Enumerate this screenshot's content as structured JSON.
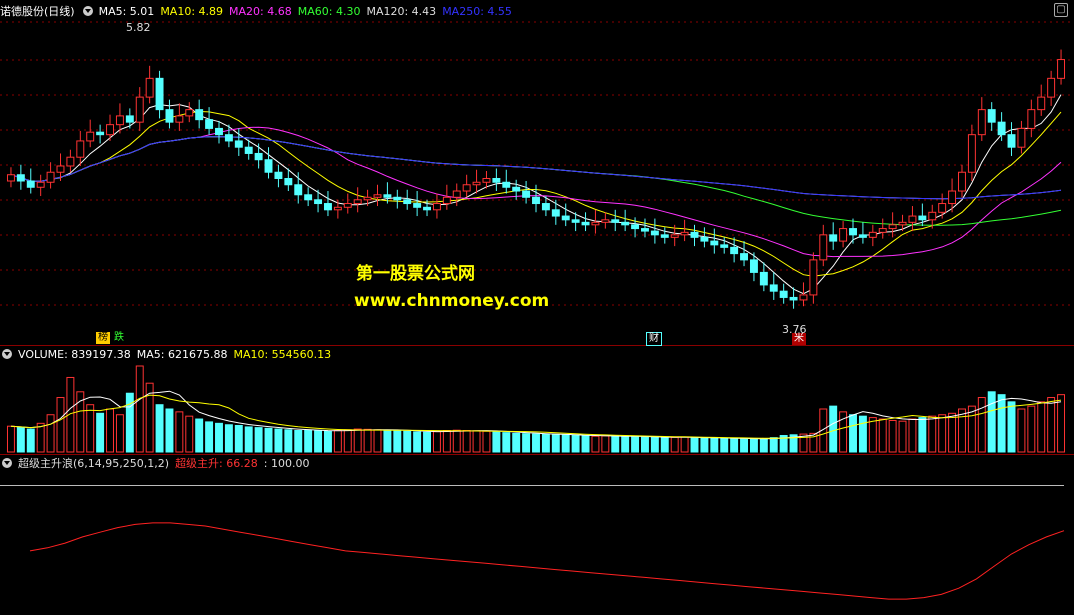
{
  "main_header": {
    "stock_name": "诺德股份(日线)",
    "ma": [
      {
        "label": "MA5: 5.01",
        "color": "#ffffff"
      },
      {
        "label": "MA10: 4.89",
        "color": "#ffff00"
      },
      {
        "label": "MA20: 4.68",
        "color": "#ff33ff"
      },
      {
        "label": "MA60: 4.30",
        "color": "#33ff33"
      },
      {
        "label": "MA120: 4.43",
        "color": "#dddddd"
      },
      {
        "label": "MA250: 4.55",
        "color": "#3333ff"
      }
    ]
  },
  "volume_header": {
    "label": "VOLUME: 839197.38",
    "ma5": "MA5: 621675.88",
    "ma10": "MA10: 554560.13"
  },
  "indicator_header": {
    "name": "超级主升浪(6,14,95,250,1,2)",
    "series": "超级主升: 66.28",
    "level": ": 100.00"
  },
  "annotations": {
    "high": "5.82",
    "low": "3.76",
    "tag_bang": "榜",
    "tag_die": "跌",
    "tag_cai": "财",
    "tag_mi": "米"
  },
  "watermark": {
    "line1": "第一股票公式网",
    "line2": "www.chnmoney.com"
  },
  "colors": {
    "up": "#ff3333",
    "down": "#54ffff",
    "grid": "#8a0000"
  },
  "chart_data": [
    {
      "type": "candlestick",
      "title": "诺德股份(日线)",
      "price_ylim": [
        3.5,
        6.0
      ],
      "high_label": 5.82,
      "low_label": 3.76,
      "ohlc_close": [
        4.78,
        4.73,
        4.68,
        4.72,
        4.8,
        4.85,
        4.92,
        5.05,
        5.12,
        5.1,
        5.18,
        5.25,
        5.2,
        5.4,
        5.55,
        5.3,
        5.2,
        5.25,
        5.3,
        5.22,
        5.15,
        5.1,
        5.05,
        5.0,
        4.95,
        4.9,
        4.8,
        4.75,
        4.7,
        4.62,
        4.58,
        4.55,
        4.5,
        4.52,
        4.55,
        4.58,
        4.6,
        4.62,
        4.6,
        4.58,
        4.55,
        4.52,
        4.5,
        4.55,
        4.6,
        4.65,
        4.7,
        4.72,
        4.75,
        4.72,
        4.68,
        4.65,
        4.6,
        4.55,
        4.5,
        4.45,
        4.42,
        4.4,
        4.38,
        4.4,
        4.42,
        4.4,
        4.38,
        4.35,
        4.33,
        4.3,
        4.28,
        4.3,
        4.32,
        4.28,
        4.25,
        4.22,
        4.2,
        4.15,
        4.1,
        4.0,
        3.9,
        3.85,
        3.8,
        3.78,
        3.82,
        4.1,
        4.3,
        4.25,
        4.35,
        4.3,
        4.28,
        4.32,
        4.35,
        4.38,
        4.4,
        4.45,
        4.42,
        4.48,
        4.55,
        4.65,
        4.8,
        5.1,
        5.3,
        5.2,
        5.1,
        5.0,
        5.15,
        5.3,
        5.4,
        5.55,
        5.7
      ]
    },
    {
      "type": "bar",
      "title": "VOLUME",
      "values": [
        180,
        170,
        160,
        200,
        260,
        380,
        520,
        420,
        330,
        270,
        300,
        260,
        410,
        600,
        480,
        330,
        300,
        280,
        250,
        230,
        210,
        200,
        190,
        185,
        175,
        170,
        165,
        160,
        155,
        150,
        150,
        148,
        145,
        150,
        155,
        160,
        158,
        155,
        150,
        148,
        145,
        140,
        138,
        142,
        150,
        152,
        150,
        148,
        145,
        140,
        135,
        130,
        128,
        125,
        122,
        120,
        118,
        115,
        112,
        110,
        112,
        110,
        108,
        106,
        104,
        102,
        100,
        102,
        104,
        100,
        98,
        96,
        95,
        94,
        92,
        90,
        92,
        100,
        115,
        120,
        125,
        130,
        300,
        320,
        280,
        260,
        250,
        240,
        230,
        220,
        215,
        230,
        240,
        250,
        260,
        270,
        300,
        320,
        380,
        420,
        400,
        350,
        300,
        320,
        350,
        380,
        400
      ],
      "ma5_label": "MA5: 621675.88",
      "ma10_label": "MA10: 554560.13"
    },
    {
      "type": "line",
      "title": "超级主升浪(6,14,95,250,1,2)",
      "series": [
        {
          "name": "超级主升",
          "values": [
            58,
            60,
            63,
            67,
            70,
            73,
            75,
            76,
            76,
            75,
            74,
            72,
            70,
            68,
            66,
            64,
            62,
            60,
            58,
            57,
            56,
            55,
            54,
            53,
            52,
            51,
            50,
            49,
            48,
            47,
            46,
            45,
            44,
            43,
            42,
            41,
            40,
            39,
            38,
            37,
            36,
            35,
            34,
            33,
            32,
            31,
            30,
            29,
            28,
            27,
            27,
            28,
            30,
            34,
            40,
            48,
            56,
            62,
            67,
            71
          ]
        }
      ],
      "level": 100.0,
      "ylim": [
        20,
        110
      ]
    }
  ]
}
